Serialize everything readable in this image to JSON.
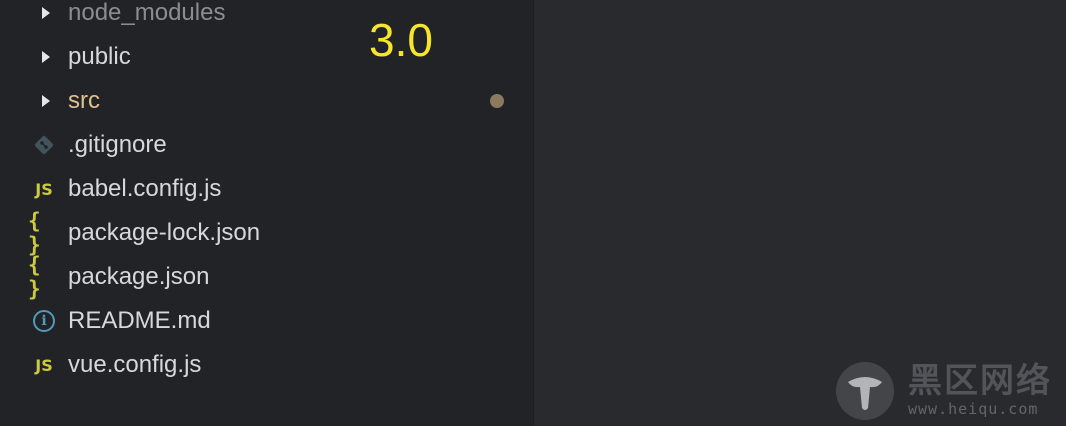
{
  "explorer": {
    "items": [
      {
        "label": "node_modules",
        "kind": "folder",
        "icon": "chevron-right-icon",
        "state": "dimmed"
      },
      {
        "label": "public",
        "kind": "folder",
        "icon": "chevron-right-icon",
        "state": "normal"
      },
      {
        "label": "src",
        "kind": "folder",
        "icon": "chevron-right-icon",
        "state": "modified"
      },
      {
        "label": ".gitignore",
        "kind": "file",
        "icon": "git-icon",
        "state": "normal"
      },
      {
        "label": "babel.config.js",
        "kind": "file",
        "icon": "javascript-icon",
        "icon_text": "JS",
        "state": "normal"
      },
      {
        "label": "package-lock.json",
        "kind": "file",
        "icon": "json-icon",
        "icon_text": "{ }",
        "state": "normal"
      },
      {
        "label": "package.json",
        "kind": "file",
        "icon": "json-icon",
        "icon_text": "{ }",
        "state": "normal"
      },
      {
        "label": "README.md",
        "kind": "file",
        "icon": "info-icon",
        "icon_text": "i",
        "state": "normal"
      },
      {
        "label": "vue.config.js",
        "kind": "file",
        "icon": "javascript-icon",
        "icon_text": "JS",
        "state": "normal"
      }
    ]
  },
  "annotation": {
    "text": "3.0",
    "color": "#f5e52c"
  },
  "watermark": {
    "title": "黑区网络",
    "url": "www.heiqu.com"
  },
  "colors": {
    "sidebar_bg": "#212327",
    "editor_bg": "#282a2e",
    "text": "#d7d8da",
    "modified_text": "#e2c08d",
    "js_icon": "#cbcb41",
    "info_icon": "#519aba",
    "git_icon": "#41535b"
  }
}
